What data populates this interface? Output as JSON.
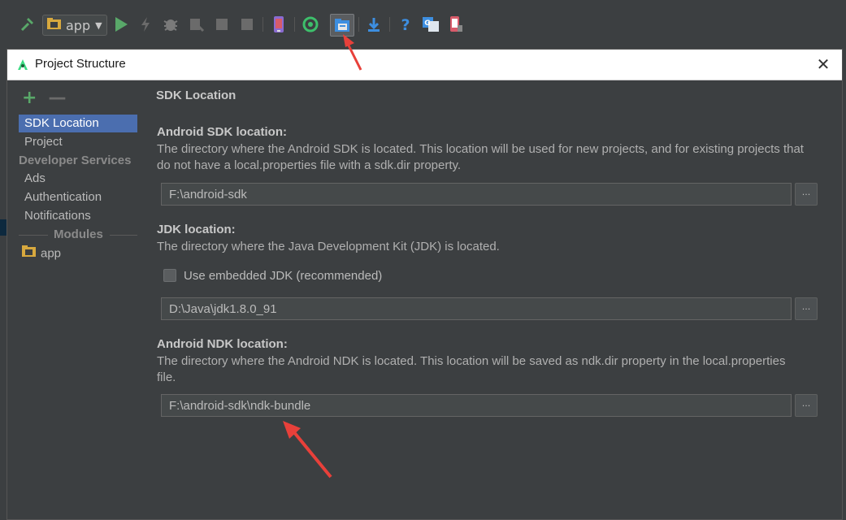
{
  "toolbar": {
    "run_config": "app"
  },
  "dialog": {
    "title": "Project Structure",
    "close_glyph": "✕"
  },
  "sidebar": {
    "add_glyph": "+",
    "remove_glyph": "—",
    "items": [
      {
        "label": "SDK Location",
        "selected": true
      },
      {
        "label": "Project"
      }
    ],
    "developer_services_header": "Developer Services",
    "service_items": [
      {
        "label": "Ads"
      },
      {
        "label": "Authentication"
      },
      {
        "label": "Notifications"
      }
    ],
    "modules_header": "Modules",
    "modules": [
      {
        "label": "app"
      }
    ]
  },
  "content": {
    "section_title": "SDK Location",
    "android_sdk": {
      "label": "Android SDK location:",
      "description": "The directory where the Android SDK is located. This location will be used for new projects, and for existing projects that do not have a local.properties file with a sdk.dir property.",
      "path": "F:\\android-sdk"
    },
    "jdk": {
      "label": "JDK location:",
      "description": "The directory where the Java Development Kit (JDK) is located.",
      "embedded_checkbox_label": "Use embedded JDK (recommended)",
      "embedded_checked": false,
      "path": "D:\\Java\\jdk1.8.0_91"
    },
    "android_ndk": {
      "label": "Android NDK location:",
      "description": "The directory where the Android NDK is located. This location will be saved as ndk.dir property in the local.properties file.",
      "path": "F:\\android-sdk\\ndk-bundle"
    },
    "browse_label": "..."
  },
  "colors": {
    "selection": "#4b6eaf",
    "annotation_arrow": "#e8403a",
    "run_green": "#59a869"
  }
}
